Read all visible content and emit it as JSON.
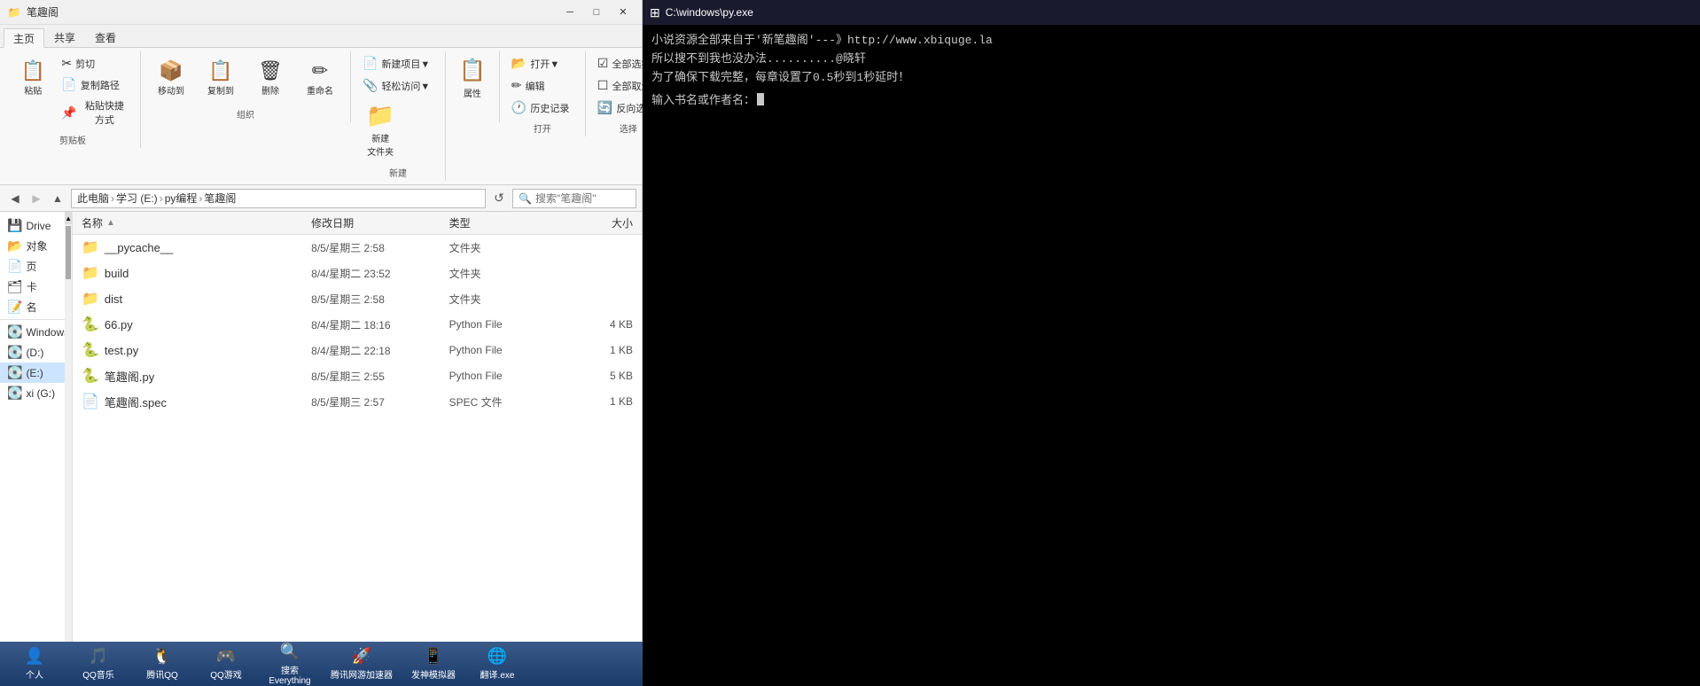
{
  "titlebar": {
    "title": "笔趣阁",
    "minimize": "─",
    "maximize": "□",
    "close": "✕"
  },
  "ribbon": {
    "tabs": [
      {
        "label": "主页",
        "active": true
      },
      {
        "label": "共享",
        "active": false
      },
      {
        "label": "查看",
        "active": false
      }
    ],
    "clipboard_group": {
      "label": "剪贴板",
      "paste_label": "粘贴",
      "cut_label": "剪切",
      "copy_path_label": "复制路径",
      "paste_shortcut_label": "粘贴快捷方式"
    },
    "organize_group": {
      "label": "组织",
      "move_label": "移动到",
      "copy_label": "复制到",
      "delete_label": "删除",
      "rename_label": "重命名"
    },
    "new_group": {
      "label": "新建",
      "new_item_label": "新建项目▼",
      "easy_access_label": "轻松访问▼",
      "new_folder_label": "新建\n文件夹"
    },
    "open_group": {
      "label": "打开",
      "open_label": "打开▼",
      "edit_label": "编辑",
      "history_label": "历史记录"
    },
    "select_group": {
      "label": "选择",
      "select_all_label": "全部选择",
      "deselect_label": "全部取消",
      "invert_label": "反向选择"
    },
    "properties_label": "属性"
  },
  "address_bar": {
    "path_parts": [
      "此电脑",
      "学习 (E:)",
      "py编程",
      "笔趣阁"
    ],
    "search_placeholder": "搜索\"笔趣阁\"",
    "search_value": "搜索\"笔趣阁\""
  },
  "sidebar": {
    "items": [
      {
        "label": "Drive",
        "icon": "💾"
      },
      {
        "label": "对象",
        "icon": "📂"
      },
      {
        "label": "页",
        "icon": "📄"
      },
      {
        "label": "卡",
        "icon": "🗂"
      },
      {
        "label": "名",
        "icon": "📝"
      },
      {
        "label": "Windows (C:)",
        "icon": "💽",
        "selected": false
      },
      {
        "label": "(D:)",
        "icon": "💽"
      },
      {
        "label": "(E:)",
        "icon": "💽",
        "selected": true
      },
      {
        "label": "xi (G:)",
        "icon": "💽"
      }
    ]
  },
  "files": {
    "columns": [
      "名称",
      "修改日期",
      "类型",
      "大小"
    ],
    "sort_col": "名称",
    "rows": [
      {
        "name": "__pycache__",
        "date": "8/5/星期三 2:58",
        "type": "文件夹",
        "size": "",
        "icon": "folder"
      },
      {
        "name": "build",
        "date": "8/4/星期二 23:52",
        "type": "文件夹",
        "size": "",
        "icon": "folder"
      },
      {
        "name": "dist",
        "date": "8/5/星期三 2:58",
        "type": "文件夹",
        "size": "",
        "icon": "folder"
      },
      {
        "name": "66.py",
        "date": "8/4/星期二 18:16",
        "type": "Python File",
        "size": "4 KB",
        "icon": "python"
      },
      {
        "name": "test.py",
        "date": "8/4/星期二 22:18",
        "type": "Python File",
        "size": "1 KB",
        "icon": "python"
      },
      {
        "name": "笔趣阁.py",
        "date": "8/5/星期三 2:55",
        "type": "Python File",
        "size": "5 KB",
        "icon": "python"
      },
      {
        "name": "笔趣阁.spec",
        "date": "8/5/星期三 2:57",
        "type": "SPEC 文件",
        "size": "1 KB",
        "icon": "spec"
      }
    ]
  },
  "cmd": {
    "title": "C:\\windows\\py.exe",
    "lines": [
      "小说资源全部来自于'新笔趣阁'---》http://www.xbiquge.la",
      "所以搜不到我也没办法..........@晓轩",
      "为了确保下载完整，每章设置了0.5秒到1秒延时！",
      "输入书名或作者名："
    ]
  },
  "taskbar": {
    "items": [
      {
        "label": "个人",
        "icon": "👤"
      },
      {
        "label": "QQ音乐",
        "icon": "🎵"
      },
      {
        "label": "腾讯QQ",
        "icon": "🐧"
      },
      {
        "label": "QQ游戏",
        "icon": "🎮"
      },
      {
        "label": "搜索\nEverything",
        "icon": "🔍"
      },
      {
        "label": "腾讯网游加速器",
        "icon": "🚀"
      },
      {
        "label": "发神模拟器",
        "icon": "📱"
      },
      {
        "label": "翻译.exe",
        "icon": "🌐"
      }
    ]
  }
}
